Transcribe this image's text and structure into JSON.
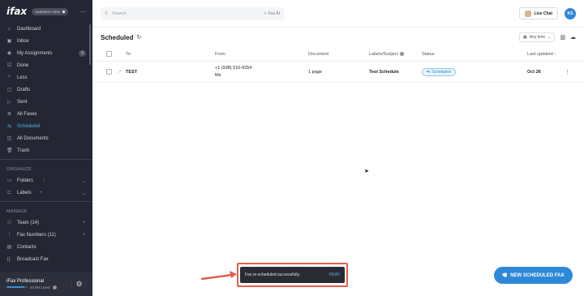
{
  "app": {
    "logo": "ifax",
    "org_badge": "SANDBOX VIEW"
  },
  "sidebar": {
    "main_items": [
      {
        "label": "Dashboard"
      },
      {
        "label": "Inbox"
      },
      {
        "label": "My Assignments",
        "count": "0"
      },
      {
        "label": "Done"
      },
      {
        "label": "Less"
      },
      {
        "label": "Drafts"
      },
      {
        "label": "Sent"
      },
      {
        "label": "All Faxes"
      },
      {
        "label": "Scheduled"
      },
      {
        "label": "All Documents"
      },
      {
        "label": "Trash"
      }
    ],
    "organize_label": "ORGANIZE",
    "folders_label": "Folders",
    "labels_label": "Labels",
    "manage_label": "MANAGE",
    "team_label": "Team (14)",
    "fax_numbers_label": "Fax Numbers (11)",
    "contacts_label": "Contacts",
    "broadcast_label": "Broadcast Fax",
    "plan_name": "iFax Professional",
    "usage_text": "84.8% Used",
    "usage_fraction": 0.848
  },
  "topbar": {
    "search_placeholder": "Search",
    "fax_ai": "Fax AI",
    "live_chat": "Live Chat",
    "avatar_initials": "KS"
  },
  "page": {
    "title": "Scheduled",
    "time_filter": "Any time"
  },
  "table": {
    "headers": {
      "to": "To",
      "from": "From",
      "document": "Document",
      "labels": "Labels/Subject",
      "status": "Status",
      "updated": "Last updated"
    },
    "rows": [
      {
        "to": "TEST",
        "from_number": "+1 (938) 510-9254",
        "from_name": "Me",
        "document": "1 page",
        "labels": "Test Schedule",
        "status": "Scheduled",
        "updated": "Oct 26"
      }
    ]
  },
  "snackbar": {
    "message": "Fax re-scheduled successfully.",
    "action": "OKAY"
  },
  "fab": {
    "label": "NEW SCHEDULED FAX"
  },
  "colors": {
    "accent": "#2e88d8",
    "highlight_frame": "#e45e4a",
    "sidebar_bg": "#242633"
  }
}
